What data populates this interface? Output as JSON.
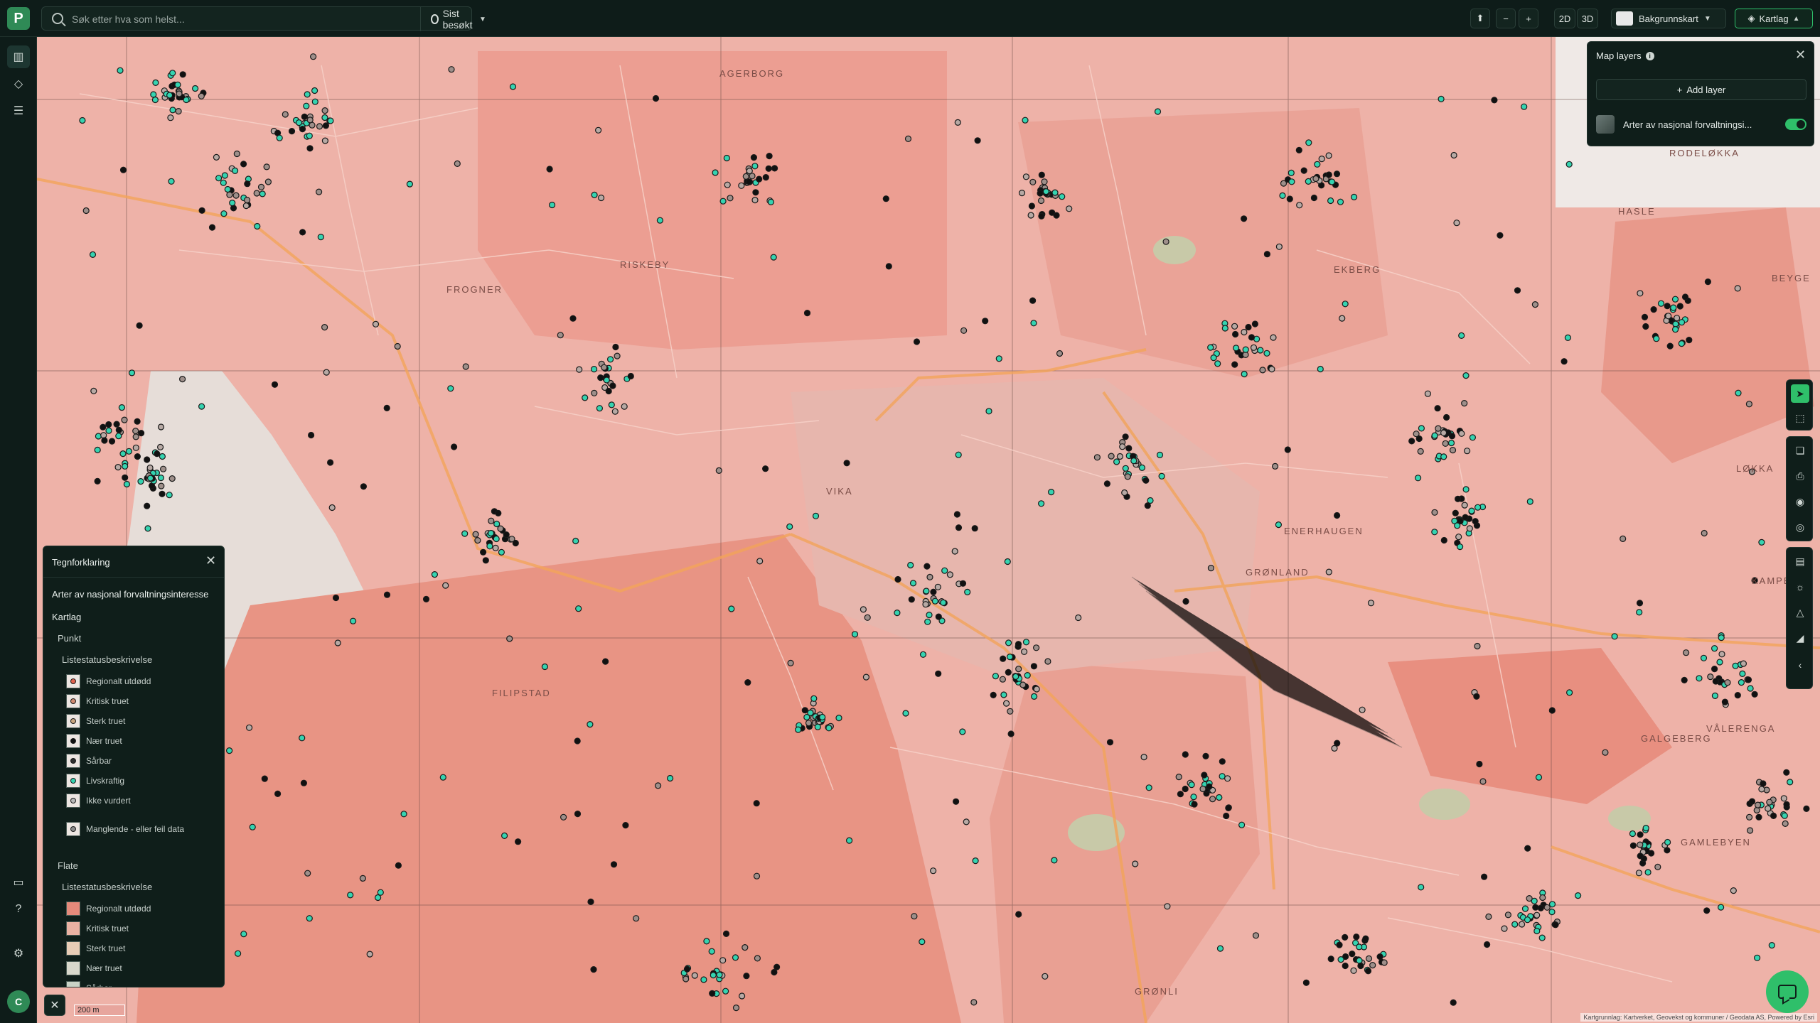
{
  "search": {
    "placeholder": "Søk etter hva som helst...",
    "recent_label": "Sist besøkt"
  },
  "toolbar": {
    "compass_label": "⬆",
    "zoom_out": "−",
    "zoom_in": "+",
    "view_2d": "2D",
    "view_3d": "3D",
    "basemap_label": "Bakgrunnskart",
    "layers_label": "Kartlag"
  },
  "map_layers": {
    "title": "Map layers",
    "add_layer": "Add layer",
    "layers": [
      {
        "name": "Arter av nasjonal forvaltningsinteresse",
        "display": "Arter av nasjonal forvaltningsi...",
        "visible": true
      }
    ]
  },
  "legend": {
    "title": "Tegnforklaring",
    "dataset": "Arter av nasjonal forvaltningsinteresse",
    "section": "Kartlag",
    "punkt": {
      "label": "Punkt",
      "group": "Listestatusbeskrivelse",
      "items": [
        {
          "label": "Regionalt utdødd",
          "color": "#e0624e"
        },
        {
          "label": "Kritisk truet",
          "color": "#d08a70"
        },
        {
          "label": "Sterk truet",
          "color": "#c8a57e"
        },
        {
          "label": "Nær truet",
          "color": "#111111"
        },
        {
          "label": "Sårbar",
          "color": "#2f2f2f"
        },
        {
          "label": "Livskraftig",
          "color": "#35d3b0"
        },
        {
          "label": "Ikke vurdert",
          "color": "#b8b8b8"
        },
        {
          "label": "Manglende - eller feil data",
          "color": "#8a8a8a"
        }
      ]
    },
    "flate": {
      "label": "Flate",
      "group": "Listestatusbeskrivelse",
      "items": [
        {
          "label": "Regionalt utdødd",
          "color": "#e58a7b"
        },
        {
          "label": "Kritisk truet",
          "color": "#eab2a3"
        },
        {
          "label": "Sterk truet",
          "color": "#e8cdb6"
        },
        {
          "label": "Nær truet",
          "color": "#d8d8cc"
        },
        {
          "label": "Sårbar",
          "color": "#c9d3c6"
        }
      ]
    }
  },
  "map": {
    "scale_label": "200 m",
    "attribution": "Kartgrunnlag: Kartverket, Geovekst og kommuner / Geodata AS, Powered by Esri",
    "place_labels": [
      "FROGNER",
      "RISKEBY",
      "RODELØKKA",
      "HASLE",
      "VIKA",
      "GRØNLAND",
      "KAMPEN",
      "GAMLEBYEN",
      "VÅLERENGA",
      "GALGEBERG",
      "ENERHAUGEN",
      "FILIPSTAD",
      "AGERBORG",
      "LØKKA",
      "EKBERG",
      "BEYGE",
      "GRØNLI"
    ]
  },
  "user": {
    "initial": "C"
  },
  "colors": {
    "accent": "#2fbf6a",
    "panel": "#0f1e1a",
    "map_base": "#e9a89f"
  }
}
